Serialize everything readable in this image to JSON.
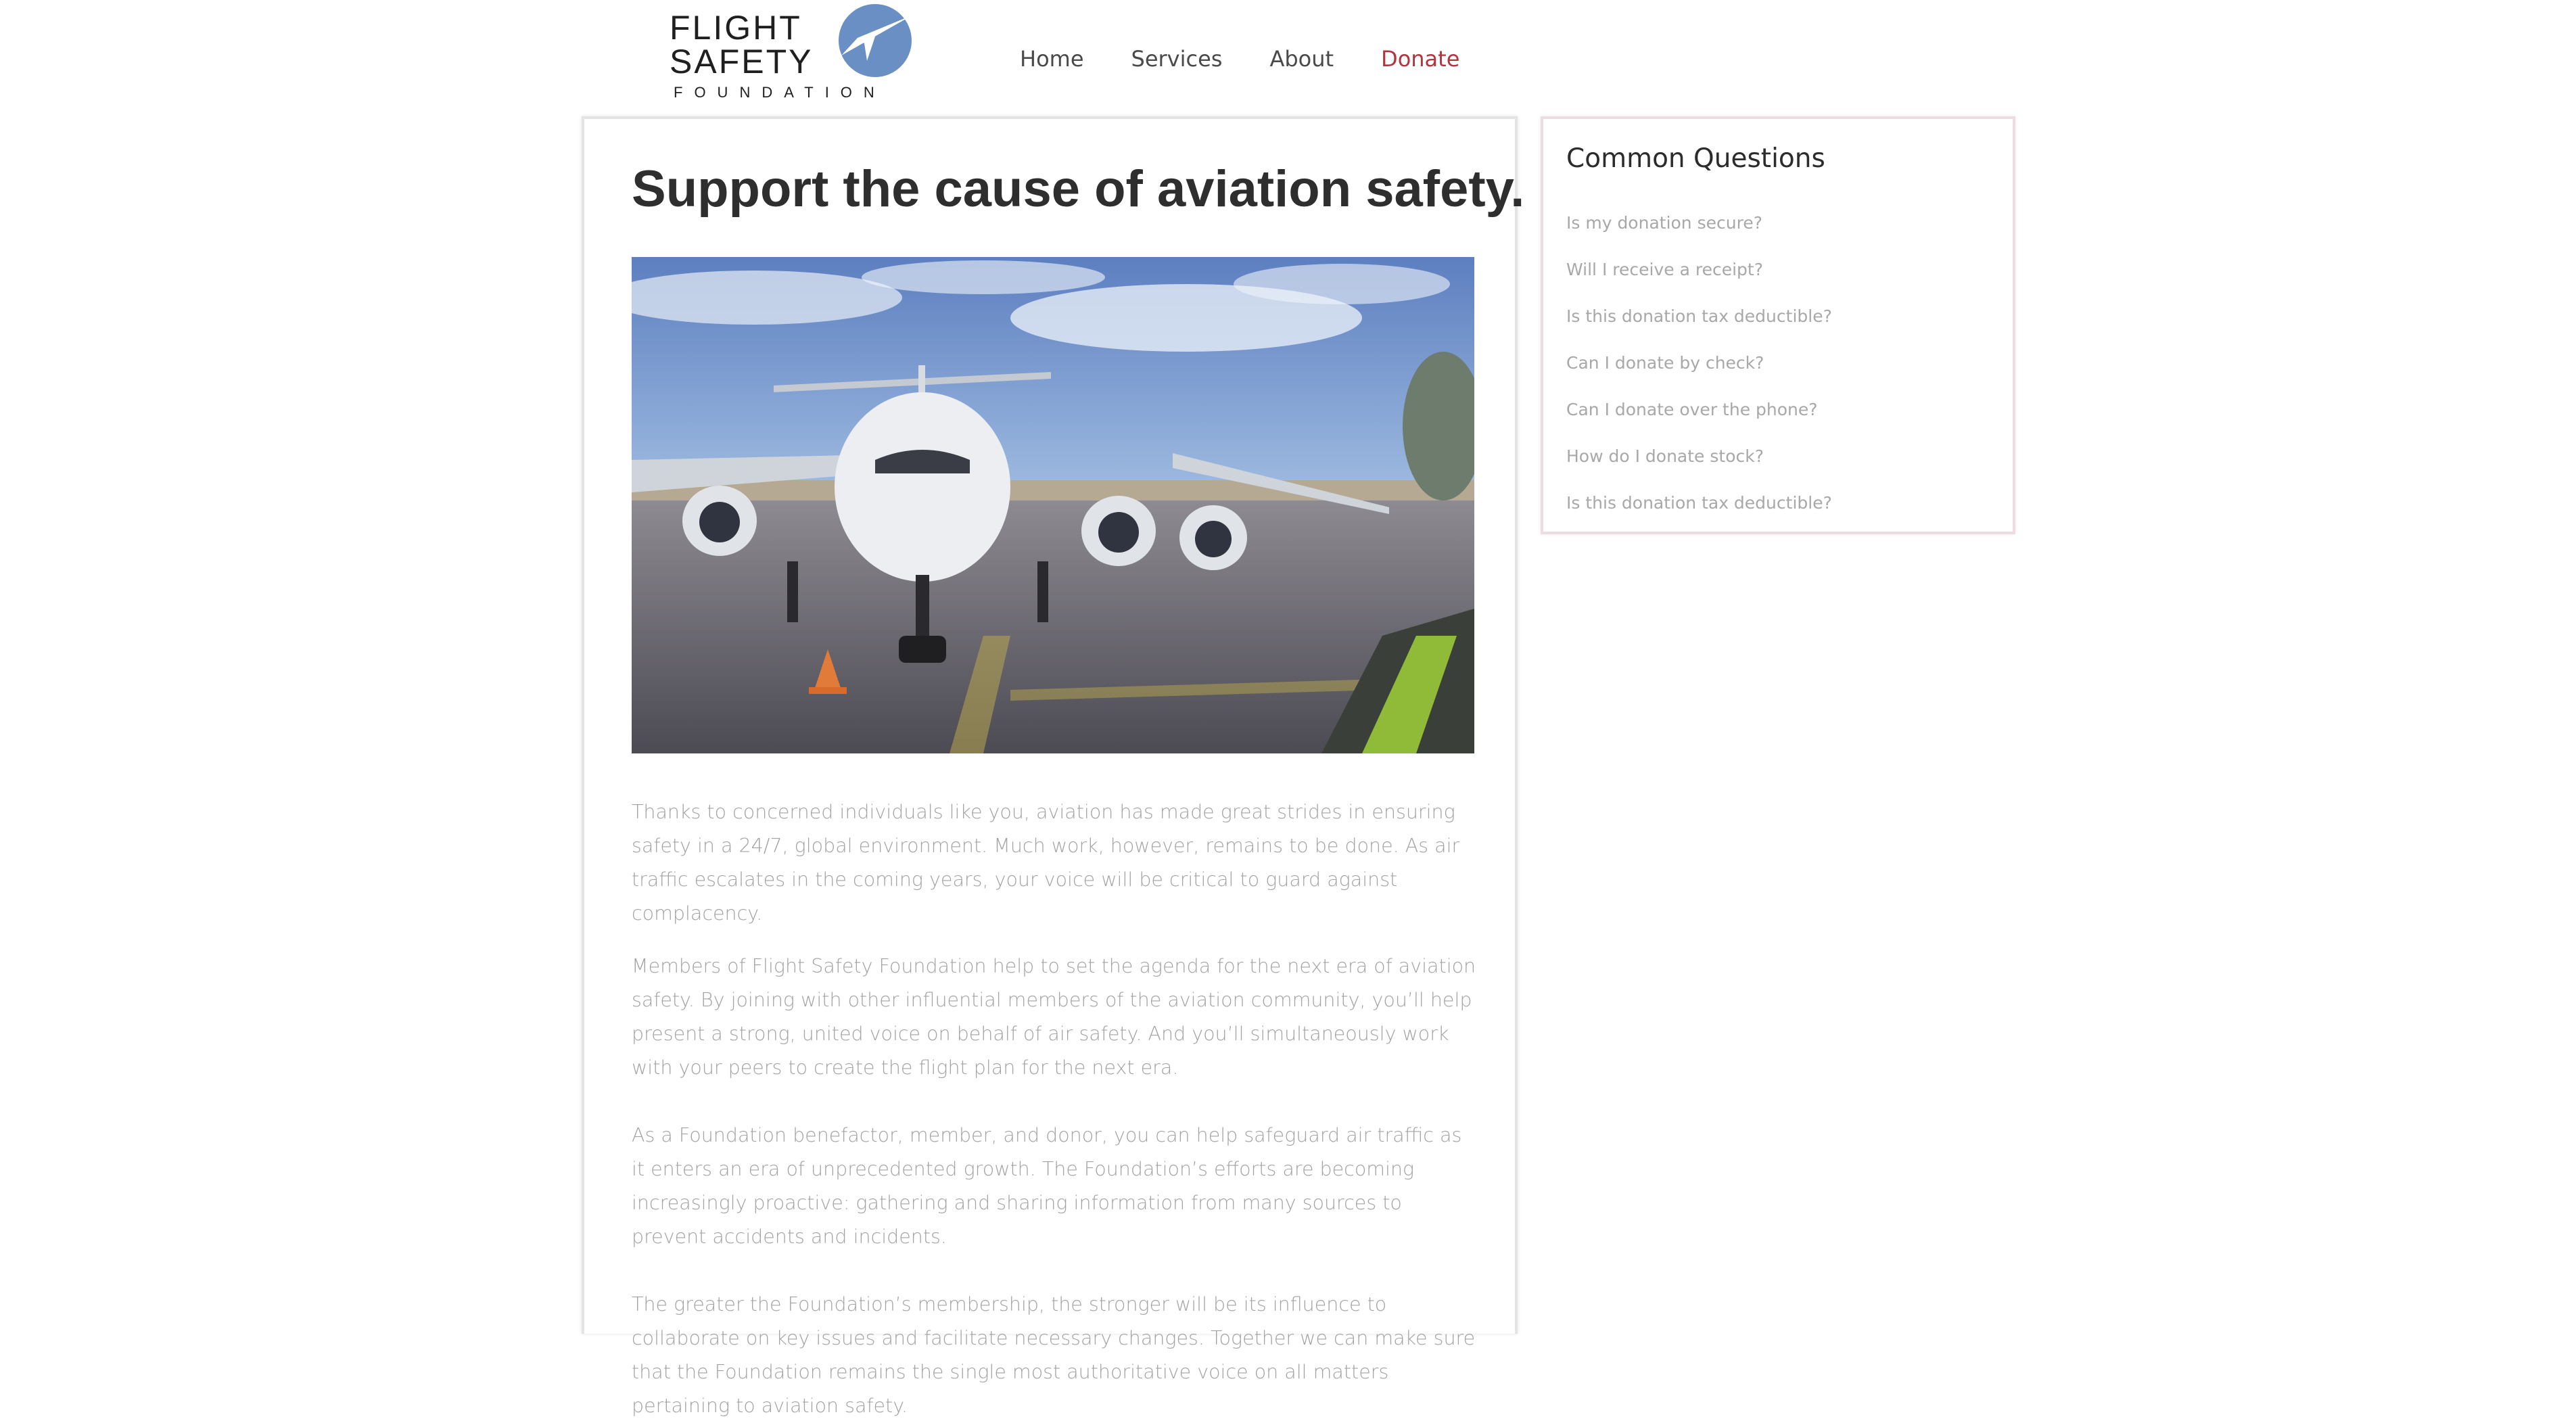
{
  "logo": {
    "line1": "FLIGHT",
    "line2": "SAFETY",
    "line3": "FOUNDATION",
    "mark_color": "#6a8fc4"
  },
  "nav": {
    "items": [
      {
        "label": "Home"
      },
      {
        "label": "Services"
      },
      {
        "label": "About"
      },
      {
        "label": "Donate",
        "active": true
      }
    ],
    "active_color": "#b3343e"
  },
  "main": {
    "title": "Support the cause of aviation safety.",
    "paragraphs": [
      "Thanks to concerned individuals like you, aviation has made great strides in ensuring safety in a 24/7, global environment. Much work, however, remains to be done. As air traffic escalates in the coming years, your voice will be critical to guard against complacency.",
      "Members of Flight Safety Foundation help to set the agenda for the next era of aviation safety. By joining with other influential members of the aviation community, you’ll help present a strong, united voice on behalf of air safety. And you’ll simultaneously work with your peers to create the flight plan for the next era.",
      "As a Foundation benefactor, member, and donor, you can help safeguard air traffic as it enters an era of unprecedented growth. The Foundation’s efforts are becoming increasingly proactive: gathering and sharing information from many sources to prevent accidents and incidents.",
      "The greater the Foundation’s membership, the stronger will be its influence to collaborate on key issues and facilitate necessary changes. Together we can make sure that the Foundation remains the single most authoritative voice on all matters pertaining to aviation safety."
    ]
  },
  "faq": {
    "title": "Common Questions",
    "items": [
      "Is my donation secure?",
      "Will I receive a receipt?",
      "Is this donation tax deductible?",
      "Can I donate by check?",
      "Can I donate over the phone?",
      "How do I donate stock?",
      "Is this donation tax deductible?"
    ]
  }
}
